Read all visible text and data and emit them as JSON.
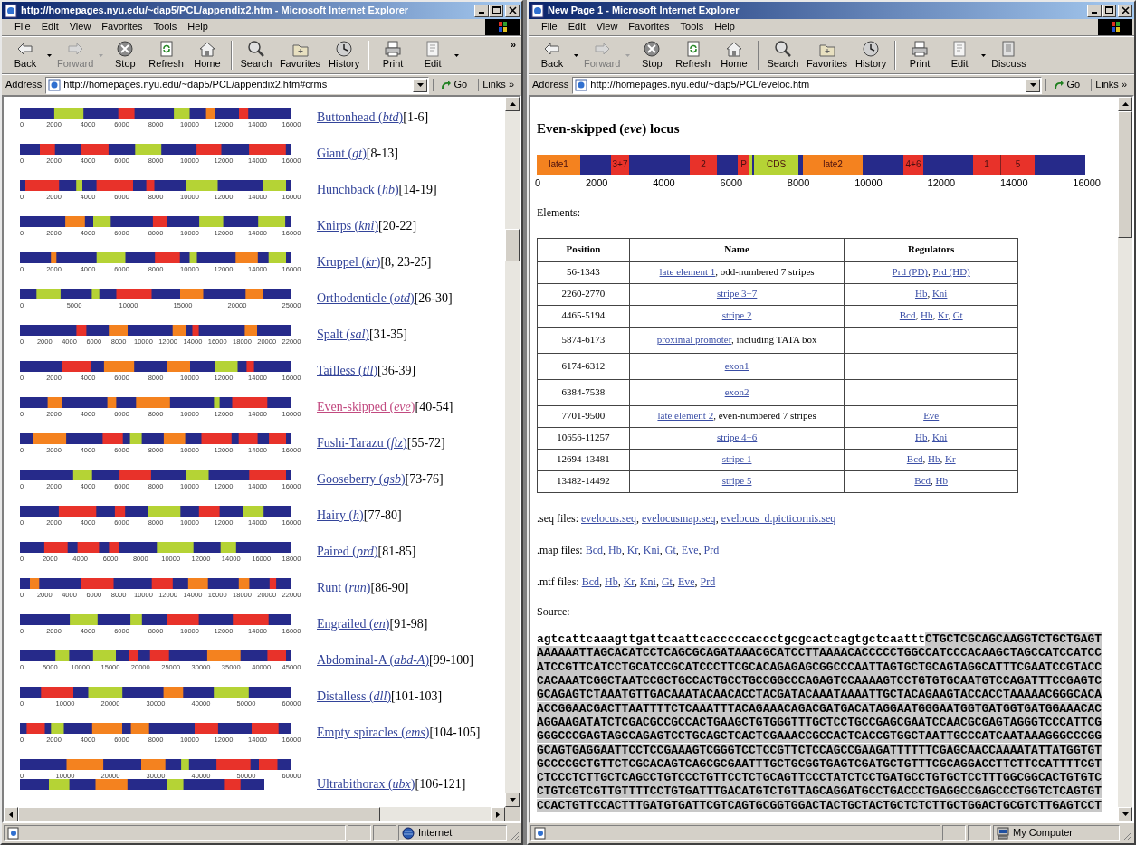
{
  "windows": [
    {
      "title": "http://homepages.nyu.edu/~dap5/PCL/appendix2.htm - Microsoft Internet Explorer",
      "menu": [
        "File",
        "Edit",
        "View",
        "Favorites",
        "Tools",
        "Help"
      ],
      "toolbar": [
        {
          "kind": "button",
          "label": "Back",
          "dropdown": true,
          "disabled": false
        },
        {
          "kind": "button",
          "label": "Forward",
          "dropdown": true,
          "disabled": true
        },
        {
          "kind": "button",
          "label": "Stop",
          "dropdown": false,
          "disabled": false
        },
        {
          "kind": "button",
          "label": "Refresh",
          "dropdown": false,
          "disabled": false
        },
        {
          "kind": "button",
          "label": "Home",
          "dropdown": false,
          "disabled": false
        },
        {
          "kind": "separator"
        },
        {
          "kind": "button",
          "label": "Search",
          "dropdown": false,
          "disabled": false
        },
        {
          "kind": "button",
          "label": "Favorites",
          "dropdown": false,
          "disabled": false
        },
        {
          "kind": "button",
          "label": "History",
          "dropdown": false,
          "disabled": false
        },
        {
          "kind": "separator"
        },
        {
          "kind": "button",
          "label": "Print",
          "dropdown": false,
          "disabled": false
        },
        {
          "kind": "button",
          "label": "Edit",
          "dropdown": true,
          "disabled": false
        },
        {
          "kind": "overflow",
          "label": "»"
        }
      ],
      "address": {
        "label": "Address",
        "url": "http://homepages.nyu.edu/~dap5/PCL/appendix2.htm#crms",
        "go": "Go",
        "links": "Links »"
      },
      "zone": {
        "kind": "internet",
        "label": "Internet"
      }
    },
    {
      "title": "New Page 1 - Microsoft Internet Explorer",
      "menu": [
        "File",
        "Edit",
        "View",
        "Favorites",
        "Tools",
        "Help"
      ],
      "toolbar": [
        {
          "kind": "button",
          "label": "Back",
          "dropdown": true,
          "disabled": false
        },
        {
          "kind": "button",
          "label": "Forward",
          "dropdown": true,
          "disabled": true
        },
        {
          "kind": "button",
          "label": "Stop",
          "dropdown": false,
          "disabled": false
        },
        {
          "kind": "button",
          "label": "Refresh",
          "dropdown": false,
          "disabled": false
        },
        {
          "kind": "button",
          "label": "Home",
          "dropdown": false,
          "disabled": false
        },
        {
          "kind": "separator"
        },
        {
          "kind": "button",
          "label": "Search",
          "dropdown": false,
          "disabled": false
        },
        {
          "kind": "button",
          "label": "Favorites",
          "dropdown": false,
          "disabled": false
        },
        {
          "kind": "button",
          "label": "History",
          "dropdown": false,
          "disabled": false
        },
        {
          "kind": "separator"
        },
        {
          "kind": "button",
          "label": "Print",
          "dropdown": false,
          "disabled": false
        },
        {
          "kind": "button",
          "label": "Edit",
          "dropdown": true,
          "disabled": false
        },
        {
          "kind": "button",
          "label": "Discuss",
          "dropdown": false,
          "disabled": false
        }
      ],
      "address": {
        "label": "Address",
        "url": "http://homepages.nyu.edu/~dap5/PCL/eveloc.htm",
        "go": "Go",
        "links": "Links »"
      },
      "zone": {
        "kind": "local",
        "label": "My Computer"
      }
    }
  ],
  "gene_list": [
    {
      "name": "Buttonhead (*btd*)",
      "refs": " [1-6]",
      "visited": false,
      "maps": [
        {
          "ticks": [
            "0",
            "2000",
            "4000",
            "6000",
            "8000",
            "10000",
            "12000",
            "14000",
            "16000"
          ]
        }
      ]
    },
    {
      "name": "Giant (*gt*)",
      "refs": " [8-13]",
      "visited": false,
      "maps": [
        {
          "ticks": [
            "0",
            "2000",
            "4000",
            "6000",
            "8000",
            "10000",
            "12000",
            "14000",
            "16000"
          ]
        }
      ]
    },
    {
      "name": "Hunchback (*hb*)",
      "refs": " [14-19]",
      "visited": false,
      "maps": [
        {
          "ticks": [
            "0",
            "2000",
            "4000",
            "6000",
            "8000",
            "10000",
            "12000",
            "14000",
            "16000"
          ]
        }
      ]
    },
    {
      "name": "Knirps (*kni*)",
      "refs": " [20-22]",
      "visited": false,
      "maps": [
        {
          "ticks": [
            "0",
            "2000",
            "4000",
            "6000",
            "8000",
            "10000",
            "12000",
            "14000",
            "16000"
          ]
        }
      ]
    },
    {
      "name": "Kruppel (*kr*)",
      "refs": " [8, 23-25]",
      "visited": false,
      "maps": [
        {
          "ticks": [
            "0",
            "2000",
            "4000",
            "6000",
            "8000",
            "10000",
            "12000",
            "14000",
            "16000"
          ]
        }
      ]
    },
    {
      "name": "Orthodenticle (*otd*)",
      "refs": " [26-30]",
      "visited": false,
      "maps": [
        {
          "ticks": [
            "0",
            "5000",
            "10000",
            "15000",
            "20000",
            "25000"
          ]
        }
      ]
    },
    {
      "name": "Spalt (*sal*)",
      "refs": " [31-35]",
      "visited": false,
      "maps": [
        {
          "ticks": [
            "0",
            "2000",
            "4000",
            "6000",
            "8000",
            "10000",
            "12000",
            "14000",
            "16000",
            "18000",
            "20000",
            "22000"
          ]
        }
      ]
    },
    {
      "name": "Tailless (*tll*)",
      "refs": " [36-39]",
      "visited": false,
      "maps": [
        {
          "ticks": [
            "0",
            "2000",
            "4000",
            "6000",
            "8000",
            "10000",
            "12000",
            "14000",
            "16000"
          ]
        }
      ]
    },
    {
      "name": "Even-skipped (*eve*)",
      "refs": " [40-54]",
      "visited": true,
      "maps": [
        {
          "ticks": [
            "0",
            "2000",
            "4000",
            "6000",
            "8000",
            "10000",
            "12000",
            "14000",
            "16000"
          ]
        }
      ]
    },
    {
      "name": "Fushi-Tarazu (*ftz*)",
      "refs": " [55-72]",
      "visited": false,
      "maps": [
        {
          "ticks": [
            "0",
            "2000",
            "4000",
            "6000",
            "8000",
            "10000",
            "12000",
            "14000",
            "16000"
          ]
        }
      ]
    },
    {
      "name": "Gooseberry (*gsb*)",
      "refs": " [73-76]",
      "visited": false,
      "maps": [
        {
          "ticks": [
            "0",
            "2000",
            "4000",
            "6000",
            "8000",
            "10000",
            "12000",
            "14000",
            "16000"
          ]
        }
      ]
    },
    {
      "name": "Hairy (*h*)",
      "refs": " [77-80]",
      "visited": false,
      "maps": [
        {
          "ticks": [
            "0",
            "2000",
            "4000",
            "6000",
            "8000",
            "10000",
            "12000",
            "14000",
            "16000"
          ]
        }
      ]
    },
    {
      "name": "Paired (*prd*)",
      "refs": " [81-85]",
      "visited": false,
      "maps": [
        {
          "ticks": [
            "0",
            "2000",
            "4000",
            "6000",
            "8000",
            "10000",
            "12000",
            "14000",
            "16000",
            "18000"
          ]
        }
      ]
    },
    {
      "name": "Runt (*run*)",
      "refs": " [86-90]",
      "visited": false,
      "maps": [
        {
          "ticks": [
            "0",
            "2000",
            "4000",
            "6000",
            "8000",
            "10000",
            "12000",
            "14000",
            "16000",
            "18000",
            "20000",
            "22000"
          ]
        }
      ]
    },
    {
      "name": "Engrailed (*en*)",
      "refs": " [91-98]",
      "visited": false,
      "maps": [
        {
          "ticks": [
            "0",
            "2000",
            "4000",
            "6000",
            "8000",
            "10000",
            "12000",
            "14000",
            "16000"
          ]
        }
      ]
    },
    {
      "name": "Abdominal-A (*abd-A*)",
      "refs": " [99-100]",
      "visited": false,
      "maps": [
        {
          "ticks": [
            "0",
            "5000",
            "10000",
            "15000",
            "20000",
            "25000",
            "30000",
            "35000",
            "40000",
            "45000"
          ]
        }
      ]
    },
    {
      "name": "Distalless (*dll*)",
      "refs": " [101-103]",
      "visited": false,
      "maps": [
        {
          "ticks": [
            "0",
            "10000",
            "20000",
            "30000",
            "40000",
            "50000",
            "60000"
          ]
        }
      ]
    },
    {
      "name": "Empty spiracles (*ems*)",
      "refs": " [104-105]",
      "visited": false,
      "maps": [
        {
          "ticks": [
            "0",
            "2000",
            "4000",
            "6000",
            "8000",
            "10000",
            "12000",
            "14000",
            "16000"
          ]
        }
      ]
    },
    {
      "name": "Ultrabithorax (*ubx*)",
      "refs": " [106-121]",
      "visited": false,
      "maps": [
        {
          "ticks": [
            "0",
            "10000",
            "20000",
            "30000",
            "40000",
            "50000",
            "60000"
          ],
          "short": false
        },
        {
          "short": true
        }
      ]
    }
  ],
  "eve_page": {
    "heading": "Even-skipped (*eve*) locus",
    "map": {
      "segments": [
        {
          "label": "late1",
          "color": "#f4821f"
        },
        {
          "color": "#262a8a"
        },
        {
          "label": "3+7",
          "color": "#e8322a"
        },
        {
          "color": "#262a8a"
        },
        {
          "label": "2",
          "color": "#e8322a"
        },
        {
          "color": "#262a8a"
        },
        {
          "label": "P",
          "color": "#e8322a"
        },
        {
          "color": "#b5d335"
        },
        {
          "color": "#262a8a"
        },
        {
          "label": "CDS",
          "color": "#b5d335"
        },
        {
          "color": "#262a8a"
        },
        {
          "label": "late2",
          "color": "#f4821f"
        },
        {
          "color": "#262a8a"
        },
        {
          "label": "4+6",
          "color": "#e8322a"
        },
        {
          "color": "#262a8a"
        },
        {
          "label": "1",
          "color": "#e8322a"
        },
        {
          "label": "5",
          "color": "#e8322a"
        },
        {
          "color": "#262a8a"
        }
      ],
      "ticks": [
        "0",
        "2000",
        "4000",
        "6000",
        "8000",
        "10000",
        "12000",
        "14000",
        "16000"
      ]
    },
    "elements_label": "Elements:",
    "table": {
      "columns": [
        "Position",
        "Name",
        "Regulators"
      ],
      "rows": [
        {
          "position": "56-1343",
          "name": {
            "link": "late element 1",
            "rest": ", odd-numbered 7 stripes"
          },
          "regulators": [
            {
              "link": "Prd (PD)",
              "sep": ", "
            },
            {
              "link": "Prd (HD)"
            }
          ]
        },
        {
          "position": "2260-2770",
          "name": {
            "link": "stripe 3+7"
          },
          "regulators": [
            {
              "link": "Hb",
              "sep": ", "
            },
            {
              "link": "Kni"
            }
          ]
        },
        {
          "position": "4465-5194",
          "name": {
            "link": "stripe 2"
          },
          "regulators": [
            {
              "link": "Bcd",
              "sep": ", "
            },
            {
              "link": "Hb",
              "sep": ", "
            },
            {
              "link": "Kr",
              "sep": ", "
            },
            {
              "link": "Gt"
            }
          ]
        },
        {
          "position": "5874-6173",
          "name": {
            "link": "proximal promoter",
            "rest": ", including TATA box"
          }
        },
        {
          "position": "6174-6312",
          "name": {
            "link": "exon1"
          }
        },
        {
          "position": "6384-7538",
          "name": {
            "link": "exon2"
          }
        },
        {
          "position": "7701-9500",
          "name": {
            "link": "late element 2",
            "rest": ", even-numbered 7 stripes"
          },
          "regulators": [
            {
              "link": "Eve"
            }
          ]
        },
        {
          "position": "10656-11257",
          "name": {
            "link": "stripe 4+6"
          },
          "regulators": [
            {
              "link": "Hb",
              "sep": ", "
            },
            {
              "link": "Kni"
            }
          ]
        },
        {
          "position": "12694-13481",
          "name": {
            "link": "stripe 1"
          },
          "regulators": [
            {
              "link": "Bcd",
              "sep": ", "
            },
            {
              "link": "Hb",
              "sep": ", "
            },
            {
              "link": "Kr"
            }
          ]
        },
        {
          "position": "13482-14492",
          "name": {
            "link": "stripe 5"
          },
          "regulators": [
            {
              "link": "Bcd",
              "sep": ", "
            },
            {
              "link": "Hb"
            }
          ]
        }
      ]
    },
    "file_lines": [
      {
        "label": ".seq files: ",
        "links": [
          {
            "link": "evelocus.seq",
            "sep": ", "
          },
          {
            "link": "evelocusmap.seq",
            "sep": ", "
          },
          {
            "link": "evelocus_d.picticornis.seq"
          }
        ]
      },
      {
        "label": ".map files: ",
        "links": [
          {
            "link": "Bcd",
            "sep": ", "
          },
          {
            "link": "Hb",
            "sep": ", "
          },
          {
            "link": "Kr",
            "sep": ", "
          },
          {
            "link": "Kni",
            "sep": ", "
          },
          {
            "link": "Gt",
            "sep": ", "
          },
          {
            "link": "Eve",
            "sep": ", "
          },
          {
            "link": "Prd"
          }
        ]
      },
      {
        "label": ".mtf files: ",
        "links": [
          {
            "link": "Bcd",
            "sep": ", "
          },
          {
            "link": "Hb",
            "sep": ", "
          },
          {
            "link": "Kr",
            "sep": ", "
          },
          {
            "link": "Kni",
            "sep": ", "
          },
          {
            "link": "Gt",
            "sep": ", "
          },
          {
            "link": "Eve",
            "sep": ", "
          },
          {
            "link": "Prd"
          }
        ]
      }
    ],
    "source_label": "Source:",
    "sequence": [
      [
        {
          "text": "agtcattcaaagttgattcaattcacccccaccctgcgcactcagtgctcaattt",
          "selected": false
        },
        {
          "text": "CTGCTCGCAGCAAGGTCTGCTGAGT",
          "selected": true
        }
      ],
      [
        {
          "text": "AAAAAATTAGCACATCCTCAGCGCAGATAAACGCATCCTTAAAACACCCCCTGGCCATCCCACAAGCTAGCCATCCATCC",
          "selected": true
        }
      ],
      [
        {
          "text": "ATCCGTTCATCCTGCATCCGCATCCCTTCGCACAGAGAGCGGCCCAATTAGTGCTGCAGTAGGCATTTCGAATCCGTACC",
          "selected": true
        }
      ],
      [
        {
          "text": "CACAAATCGGCTAATCCGCTGCCACTGCCTGCCGGCCCAGAGTCCAAAAGTCCTGTGTGCAATGTCCAGATTTCCGAGTC",
          "selected": true
        }
      ],
      [
        {
          "text": "GCAGAGTCTAAATGTTGACAAATACAACACCTACGATACAAATAAAATTGCTACAGAAGTACCACCTAAAAACGGGCACA",
          "selected": true
        }
      ],
      [
        {
          "text": "ACCGGAACGACTTAATTTTCTCAAATTTACAGAAACAGACGATGACATAGGAATGGGAATGGTGATGGTGATGGAAACAC",
          "selected": true
        }
      ],
      [
        {
          "text": "AGGAAGATATCTCGACGCCGCCACTGAAGCTGTGGGTTTGCTCCTGCCGAGCGAATCCAACGCGAGTAGGGTCCCATTCG",
          "selected": true
        }
      ],
      [
        {
          "text": "GGGCCCGAGTAGCCAGAGTCCTGCAGCTCACTCGAAACCGCCACTCACCGTGGCTAATTGCCCATCAATAAAGGGCCCGG",
          "selected": true
        }
      ],
      [
        {
          "text": "GCAGTGAGGAATTCCTCCGAAAGTCGGGTCCTCCGTTCTCCAGCCGAAGATTTTTTCGAGCAACCAAAATATTATGGTGT",
          "selected": true
        }
      ],
      [
        {
          "text": "GCCCCGCTGTTCTCGCACAGTCAGCGCGAATTTGCTGCGGTGAGTCGATGCTGTTTCGCAGGACCTTCTTCCATTTTCGT",
          "selected": true
        }
      ],
      [
        {
          "text": "CTCCCTCTTGCTCAGCCTGTCCCTGTTCCTCTGCAGTTCCCTATCTCCTGATGCCTGTGCTCCTTTGGCGGCACTGTGTC",
          "selected": true
        }
      ],
      [
        {
          "text": "CTGTCGTCGTTGTTTTCCTGTGATTTGACATGTCTGTTAGCAGGATGCCTGACCCTGAGGCCGAGCCCTGGTCTCAGTGT",
          "selected": true
        }
      ],
      [
        {
          "text": "CCACTGTTCCACTTTGATGTGATTCGTCAGTGCGGTGGACTACTGCTACTGCTCTCTTGCTGGACTGCGTCTTGAGTCCT",
          "selected": true
        }
      ]
    ]
  }
}
